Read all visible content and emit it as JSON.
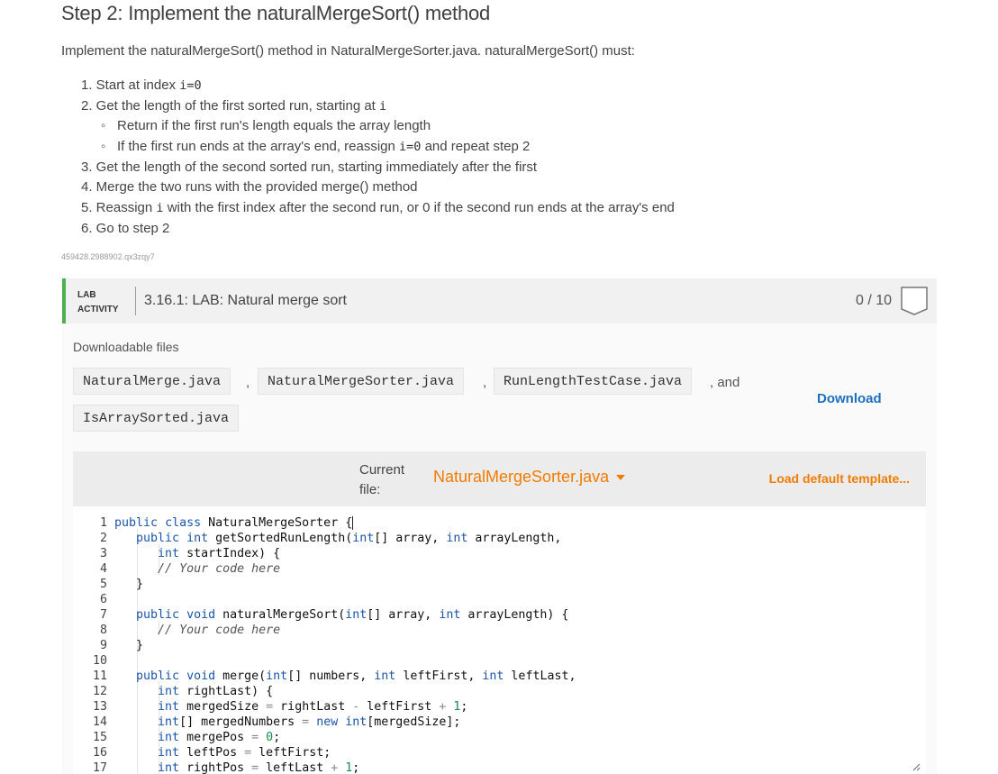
{
  "header": {
    "title": "Step 2: Implement the naturalMergeSort() method"
  },
  "intro": "Implement the naturalMergeSort() method in NaturalMergeSorter.java. naturalMergeSort() must:",
  "steps": [
    {
      "pre": "1. Start at index ",
      "code": "i=0",
      "post": "",
      "sub": false
    },
    {
      "pre": "2. Get the length of the first sorted run, starting at ",
      "code": "i",
      "post": "",
      "sub": false
    },
    {
      "pre": "Return if the first run's length equals the array length",
      "code": "",
      "post": "",
      "sub": true
    },
    {
      "pre": "If the first run ends at the array's end, reassign ",
      "code": "i=0",
      "post": " and repeat step 2",
      "sub": true
    },
    {
      "pre": "3. Get the length of the second sorted run, starting immediately after the first",
      "code": "",
      "post": "",
      "sub": false
    },
    {
      "pre": "4. Merge the two runs with the provided merge() method",
      "code": "",
      "post": "",
      "sub": false
    },
    {
      "pre": "5. Reassign ",
      "code": "i",
      "post": " with the first index after the second run, or 0 if the second run ends at the array's end",
      "sub": false
    },
    {
      "pre": "6. Go to step 2",
      "code": "",
      "post": "",
      "sub": false
    }
  ],
  "file_id": "459428.2988902.qx3zqy7",
  "lab": {
    "tag_line1": "LAB",
    "tag_line2": "ACTIVITY",
    "name": "3.16.1: LAB: Natural merge sort",
    "score": "0 / 10",
    "accent_color": "#4caf50"
  },
  "downloads": {
    "label": "Downloadable files",
    "files": [
      "NaturalMerge.java",
      "NaturalMergeSorter.java",
      "RunLengthTestCase.java",
      "IsArraySorted.java"
    ],
    "separator": ",",
    "conjunction": ", and",
    "download_label": "Download",
    "link_color": "#1f6fbf"
  },
  "editor": {
    "current_file_label": "Current file:",
    "current_file": "NaturalMergeSorter.java",
    "load_template_label": "Load default template...",
    "accent_color": "#f07c00",
    "lines": [
      "public class NaturalMergeSorter {",
      "   public int getSortedRunLength(int[] array, int arrayLength,",
      "      int startIndex) {",
      "      // Your code here",
      "   }",
      "",
      "   public void naturalMergeSort(int[] array, int arrayLength) {",
      "      // Your code here",
      "   }",
      "",
      "   public void merge(int[] numbers, int leftFirst, int leftLast,",
      "      int rightLast) {",
      "      int mergedSize = rightLast - leftFirst + 1;",
      "      int[] mergedNumbers = new int[mergedSize];",
      "      int mergePos = 0;",
      "      int leftPos = leftFirst;",
      "      int rightPos = leftLast + 1;"
    ]
  }
}
